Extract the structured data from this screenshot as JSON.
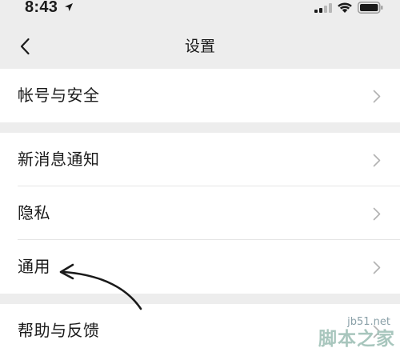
{
  "status_bar": {
    "time": "8:43",
    "icons": [
      "location-arrow-icon",
      "signal-icon",
      "wifi-icon",
      "battery-icon"
    ]
  },
  "nav": {
    "back_icon": "chevron-left-icon",
    "title": "设置"
  },
  "groups": [
    {
      "items": [
        {
          "label": "帐号与安全"
        }
      ]
    },
    {
      "items": [
        {
          "label": "新消息通知"
        },
        {
          "label": "隐私"
        },
        {
          "label": "通用"
        }
      ]
    },
    {
      "items": [
        {
          "label": "帮助与反馈"
        }
      ]
    }
  ],
  "annotation": {
    "type": "arrow",
    "points_to": "通用",
    "color": "#1a1a1a"
  },
  "watermark": {
    "url": "jb51.net",
    "name": "脚本之家"
  },
  "colors": {
    "page_background": "#ededed",
    "cell_background": "#ffffff",
    "divider": "#e5e5e5",
    "chevron": "#b2b2b2",
    "text": "#1a1a1a"
  }
}
